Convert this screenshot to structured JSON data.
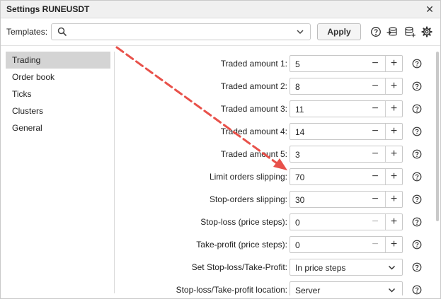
{
  "window": {
    "title": "Settings RUNEUSDT",
    "close_glyph": "✕"
  },
  "toolbar": {
    "templates_label": "Templates:",
    "search_value": "",
    "apply_label": "Apply",
    "icons": [
      "help-icon",
      "template-list-icon",
      "database-add-icon",
      "gear-icon"
    ]
  },
  "sidebar": {
    "items": [
      {
        "label": "Trading",
        "active": true
      },
      {
        "label": "Order book",
        "active": false
      },
      {
        "label": "Ticks",
        "active": false
      },
      {
        "label": "Clusters",
        "active": false
      },
      {
        "label": "General",
        "active": false
      }
    ]
  },
  "form": {
    "rows": [
      {
        "label": "Traded amount  1:",
        "type": "spinner",
        "value": "5"
      },
      {
        "label": "Traded amount  2:",
        "type": "spinner",
        "value": "8"
      },
      {
        "label": "Traded amount  3:",
        "type": "spinner",
        "value": "11"
      },
      {
        "label": "Traded amount  4:",
        "type": "spinner",
        "value": "14"
      },
      {
        "label": "Traded amount  5:",
        "type": "spinner",
        "value": "3"
      },
      {
        "label": "Limit orders slipping:",
        "type": "spinner",
        "value": "70"
      },
      {
        "label": "Stop-orders slipping:",
        "type": "spinner",
        "value": "30"
      },
      {
        "label": "Stop-loss (price steps):",
        "type": "spinner",
        "value": "0",
        "minus_disabled": true
      },
      {
        "label": "Take-profit (price steps):",
        "type": "spinner",
        "value": "0",
        "minus_disabled": true
      },
      {
        "label": "Set Stop-loss/Take-Profit:",
        "type": "select",
        "value": "In price steps"
      },
      {
        "label": "Stop-loss/Take-profit location:",
        "type": "select",
        "value": "Server"
      }
    ]
  },
  "glyphs": {
    "minus": "−",
    "plus": "+"
  },
  "colors": {
    "arrow": "#e8514a",
    "active_item": "#d4d4d4",
    "title_bg": "#f0f0f0"
  }
}
